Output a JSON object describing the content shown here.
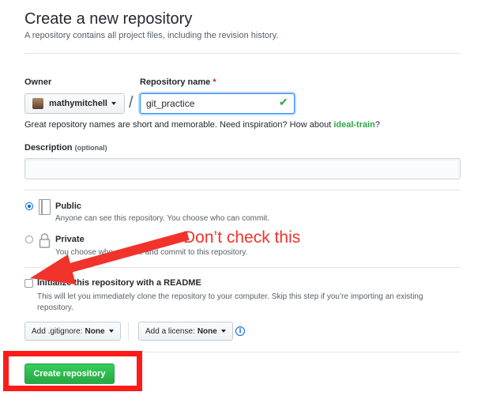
{
  "page": {
    "title": "Create a new repository",
    "subtitle": "A repository contains all project files, including the revision history."
  },
  "owner": {
    "label": "Owner",
    "value": "mathymitchell"
  },
  "repo_name": {
    "label": "Repository name",
    "required_mark": "*",
    "value": "git_practice",
    "separator": "/"
  },
  "hint": {
    "text": "Great repository names are short and memorable. Need inspiration? How about ",
    "suggestion": "ideal-train",
    "end": "?"
  },
  "description": {
    "label": "Description",
    "optional": "(optional)",
    "value": ""
  },
  "visibility": {
    "selected": "public",
    "public": {
      "label": "Public",
      "note": "Anyone can see this repository. You choose who can commit."
    },
    "private": {
      "label": "Private",
      "note_visible": "You choose who can see and commit to this repository."
    }
  },
  "init_readme": {
    "checked": false,
    "label": "Initialize this repository with a README",
    "note": "This will let you immediately clone the repository to your computer. Skip this step if you’re importing an existing repository."
  },
  "gitignore": {
    "prefix": "Add .gitignore:",
    "value": "None"
  },
  "license": {
    "prefix": "Add a license:",
    "value": "None"
  },
  "submit": {
    "label": "Create repository"
  },
  "annotation": {
    "text": "Don’t check this",
    "color": "#f0332b"
  },
  "colors": {
    "primary_button": "#28a745",
    "accent_blue": "#0366d6",
    "highlight_red": "#ff1a1a"
  }
}
